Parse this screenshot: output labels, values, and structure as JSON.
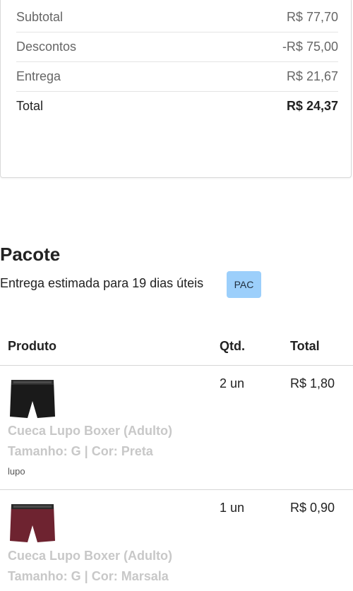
{
  "summary": {
    "rows": [
      {
        "label": "Subtotal",
        "value": "R$ 77,70"
      },
      {
        "label": "Descontos",
        "value": "-R$ 75,00"
      },
      {
        "label": "Entrega",
        "value": "R$ 21,67"
      },
      {
        "label": "Total",
        "value": "R$ 24,37"
      }
    ]
  },
  "package": {
    "title": "Pacote",
    "estimate": "Entrega estimada para 19 dias úteis",
    "badge": "PAC"
  },
  "table": {
    "headers": {
      "product": "Produto",
      "qty": "Qtd.",
      "total": "Total"
    },
    "items": [
      {
        "name": "Cueca Lupo Boxer (Adulto)",
        "variant": "Tamanho: G | Cor: Preta",
        "brand": "lupo",
        "qty": "2 un",
        "total": "R$ 1,80",
        "color": "#1a1a1a"
      },
      {
        "name": "Cueca Lupo Boxer (Adulto)",
        "variant": "Tamanho: G | Cor: Marsala",
        "brand": "",
        "qty": "1 un",
        "total": "R$ 0,90",
        "color": "#6e2330"
      }
    ]
  }
}
